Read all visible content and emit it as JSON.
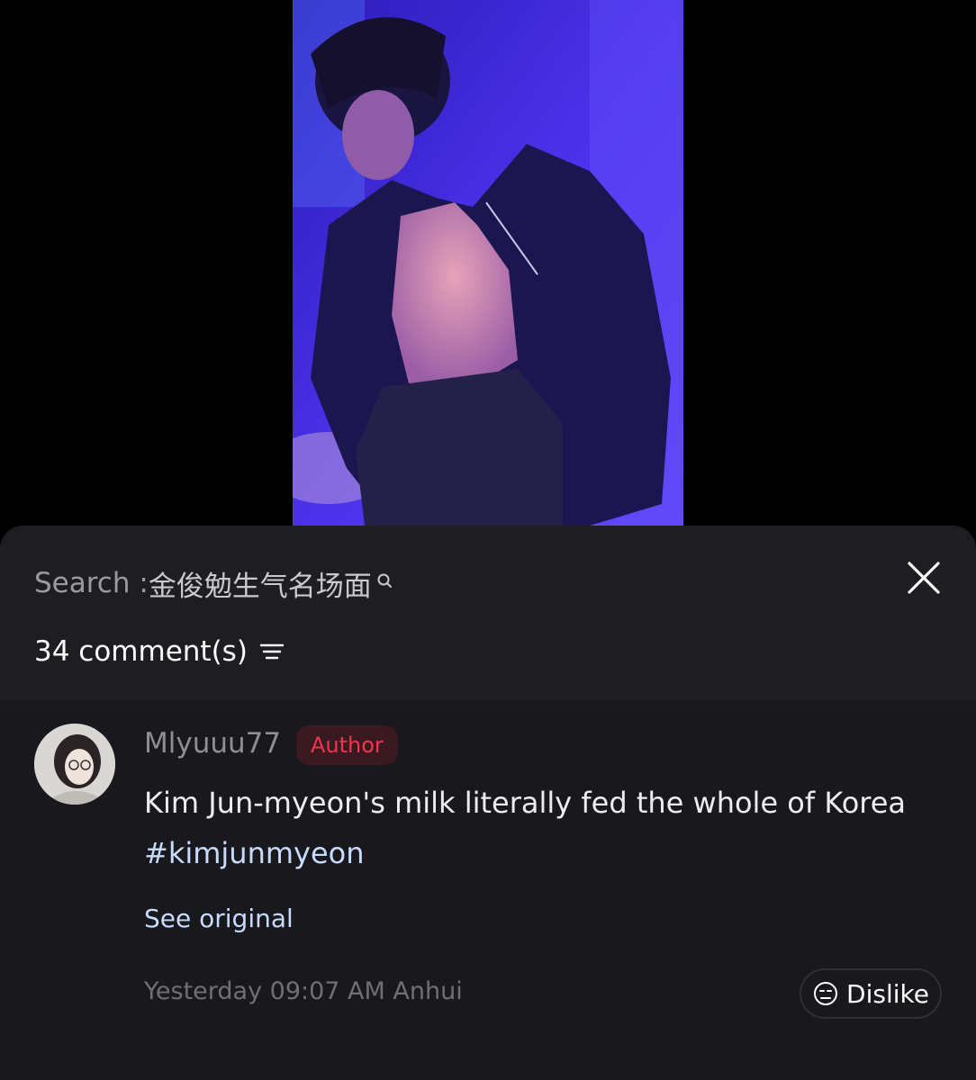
{
  "sheet": {
    "search_label": "Search : ",
    "search_query": "金俊勉生气名场面",
    "comment_count": "34 comment(s)"
  },
  "comment": {
    "username": "Mlyuuu77",
    "badge": "Author",
    "text": "Kim Jun-myeon's milk literally fed the whole of Korea",
    "hashtag": "#kimjunmyeon",
    "see_original": "See original",
    "timestamp": "Yesterday 09:07 AM Anhui",
    "dislike_label": "Dislike"
  },
  "icons": {
    "search": "search-icon",
    "close": "close-icon",
    "sort": "sort-icon",
    "dislike": "dislike-face-icon"
  },
  "colors": {
    "sheet_bg": "#1c1c21",
    "badge_text": "#f0344f",
    "link": "#c6dbff"
  }
}
